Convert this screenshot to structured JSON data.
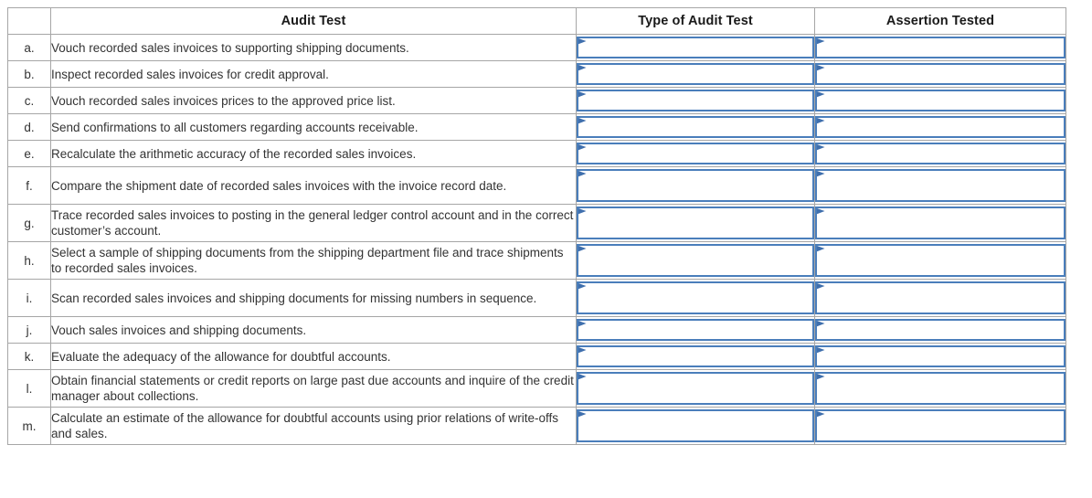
{
  "table": {
    "columns": [
      {
        "key": "letter",
        "label": ""
      },
      {
        "key": "audit_test",
        "label": "Audit Test"
      },
      {
        "key": "type_of_audit_test",
        "label": "Type of Audit Test"
      },
      {
        "key": "assertion_tested",
        "label": "Assertion Tested"
      }
    ],
    "header": {
      "blank": "",
      "audit_test": "Audit Test",
      "type_of_audit_test": "Type of Audit Test",
      "assertion_tested": "Assertion Tested"
    },
    "rows": [
      {
        "letter": "a.",
        "audit_test": "Vouch recorded sales invoices to supporting shipping documents.",
        "type_of_audit_test": "",
        "assertion_tested": "",
        "lines": 1
      },
      {
        "letter": "b.",
        "audit_test": "Inspect recorded sales invoices for credit approval.",
        "type_of_audit_test": "",
        "assertion_tested": "",
        "lines": 1
      },
      {
        "letter": "c.",
        "audit_test": "Vouch recorded sales invoices prices to the approved price list.",
        "type_of_audit_test": "",
        "assertion_tested": "",
        "lines": 1
      },
      {
        "letter": "d.",
        "audit_test": "Send confirmations to all customers regarding accounts receivable.",
        "type_of_audit_test": "",
        "assertion_tested": "",
        "lines": 1
      },
      {
        "letter": "e.",
        "audit_test": "Recalculate the arithmetic accuracy of the recorded sales invoices.",
        "type_of_audit_test": "",
        "assertion_tested": "",
        "lines": 1
      },
      {
        "letter": "f.",
        "audit_test": "Compare the shipment date of recorded sales invoices with the invoice record date.",
        "type_of_audit_test": "",
        "assertion_tested": "",
        "lines": 2
      },
      {
        "letter": "g.",
        "audit_test": "Trace recorded sales invoices to posting in the general ledger control account and in the correct customer’s account.",
        "type_of_audit_test": "",
        "assertion_tested": "",
        "lines": 2
      },
      {
        "letter": "h.",
        "audit_test": "Select a sample of shipping documents from the shipping department file and trace shipments to recorded sales invoices.",
        "type_of_audit_test": "",
        "assertion_tested": "",
        "lines": 2
      },
      {
        "letter": "i.",
        "audit_test": "Scan recorded sales invoices and shipping documents for missing numbers in sequence.",
        "type_of_audit_test": "",
        "assertion_tested": "",
        "lines": 2
      },
      {
        "letter": "j.",
        "audit_test": "Vouch sales invoices and shipping documents.",
        "type_of_audit_test": "",
        "assertion_tested": "",
        "lines": 1
      },
      {
        "letter": "k.",
        "audit_test": "Evaluate the adequacy of the allowance for doubtful accounts.",
        "type_of_audit_test": "",
        "assertion_tested": "",
        "lines": 1
      },
      {
        "letter": "l.",
        "audit_test": "Obtain financial statements or credit reports on large past due accounts and inquire of the credit manager about collections.",
        "type_of_audit_test": "",
        "assertion_tested": "",
        "lines": 2
      },
      {
        "letter": "m.",
        "audit_test": "Calculate an estimate of the allowance for doubtful accounts using prior relations of write-offs and sales.",
        "type_of_audit_test": "",
        "assertion_tested": "",
        "lines": 2
      }
    ]
  },
  "icons": {
    "dropdown_marker": "dropdown-flag-icon"
  },
  "colors": {
    "header_fill": "#7CACE0",
    "grid_line": "#a6a6a6",
    "dropdown_border": "#4a7ebb",
    "text": "#333333",
    "header_text": "#1a1a1a",
    "page_background": "#ffffff"
  }
}
